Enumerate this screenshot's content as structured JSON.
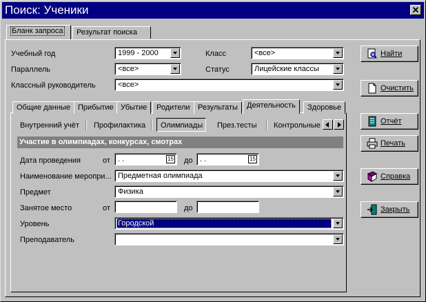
{
  "window": {
    "title": "Поиск: Ученики"
  },
  "top_tabs": [
    {
      "label": "Бланк запроса"
    },
    {
      "label": "Результат поиска"
    }
  ],
  "form": {
    "year_label": "Учебный год",
    "year_value": "1999 - 2000",
    "class_label": "Класс",
    "class_value": "<все>",
    "parallel_label": "Параллель",
    "parallel_value": "<все>",
    "status_label": "Статус",
    "status_value": "Лицейские классы",
    "teacher_label": "Классный руководитель",
    "teacher_value": "<все>"
  },
  "section_tabs": [
    {
      "label": "Общие данные"
    },
    {
      "label": "Прибытие"
    },
    {
      "label": "Убытие"
    },
    {
      "label": "Родители"
    },
    {
      "label": "Результаты"
    },
    {
      "label": "Деятельность"
    },
    {
      "label": "Здоровье"
    }
  ],
  "activity_tabs": [
    {
      "label": "Внутренний учёт"
    },
    {
      "label": "Профилактика"
    },
    {
      "label": "Олимпиады"
    },
    {
      "label": "През.тесты"
    },
    {
      "label": "Контрольные"
    }
  ],
  "olympiad": {
    "header": "Участие в олимпиадах, конкурсах, смотрах",
    "date_label": "Дата проведения",
    "from": "от",
    "to": "до",
    "date_from": " .  .",
    "date_to": " .  .",
    "cal": "15",
    "event_label": "Наименование меропри...",
    "event_value": "Предметная олимпиада",
    "subject_label": "Предмет",
    "subject_value": "Физика",
    "place_label": "Занятое место",
    "place_from": "",
    "place_to": "",
    "level_label": "Уровень",
    "level_value": "Городской",
    "teacher_label": "Преподаватель",
    "teacher_value": ""
  },
  "buttons": {
    "find": "Найти",
    "clear": "Очистить",
    "report": "Отчёт",
    "print": "Печать",
    "help": "Справка",
    "close": "Закрыть"
  },
  "colors": {
    "titlebar": "#000080",
    "face": "#c0c0c0",
    "selection": "#000080",
    "section_bar": "#808080"
  }
}
